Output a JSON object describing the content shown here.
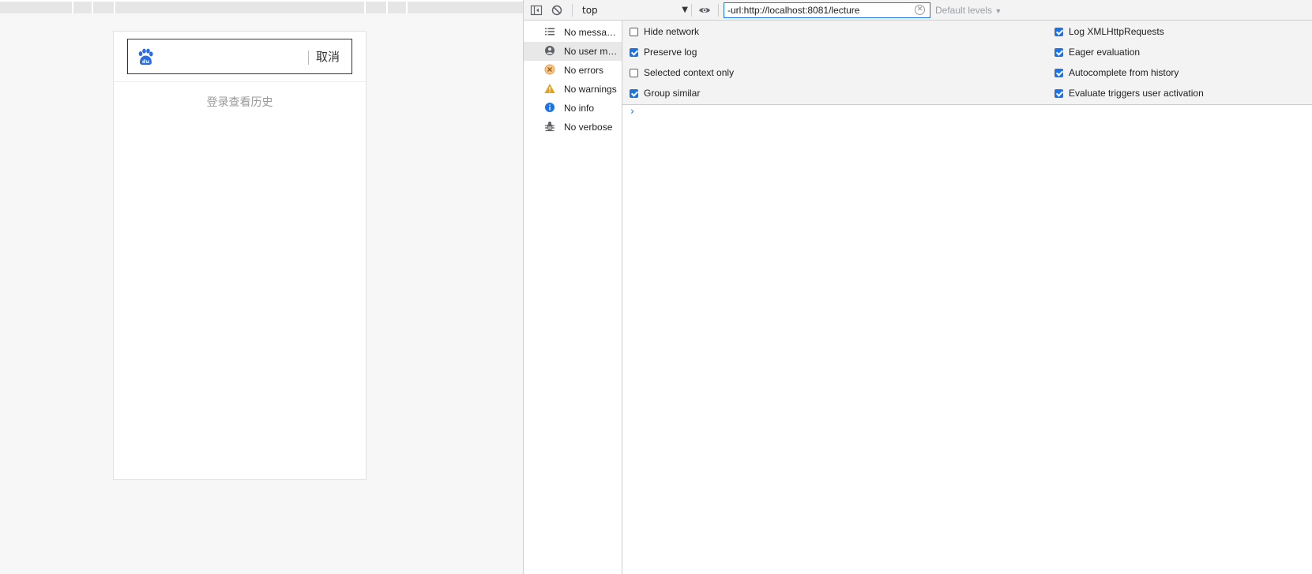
{
  "preview": {
    "cancel_label": "取消",
    "search_placeholder": "",
    "history_hint": "登录查看历史"
  },
  "toolbar": {
    "context": "top",
    "filter_value": "-url:http://localhost:8081/lecture",
    "levels_label": "Default levels",
    "levels_arrow": "▼",
    "context_arrow": "▼"
  },
  "sidebar": {
    "items": [
      {
        "label": "No messages",
        "icon": "list-icon"
      },
      {
        "label": "No user me...",
        "icon": "user-icon"
      },
      {
        "label": "No errors",
        "icon": "error-icon"
      },
      {
        "label": "No warnings",
        "icon": "warning-icon"
      },
      {
        "label": "No info",
        "icon": "info-icon"
      },
      {
        "label": "No verbose",
        "icon": "bug-icon"
      }
    ]
  },
  "settings": {
    "left": [
      {
        "label": "Hide network",
        "checked": false
      },
      {
        "label": "Preserve log",
        "checked": true
      },
      {
        "label": "Selected context only",
        "checked": false
      },
      {
        "label": "Group similar",
        "checked": true
      }
    ],
    "right": [
      {
        "label": "Log XMLHttpRequests",
        "checked": true
      },
      {
        "label": "Eager evaluation",
        "checked": true
      },
      {
        "label": "Autocomplete from history",
        "checked": true
      },
      {
        "label": "Evaluate triggers user activation",
        "checked": true
      }
    ]
  },
  "console": {
    "prompt": "›"
  },
  "colors": {
    "accent": "#1a73e8",
    "error": "#d93025",
    "warning": "#e3a21a"
  }
}
